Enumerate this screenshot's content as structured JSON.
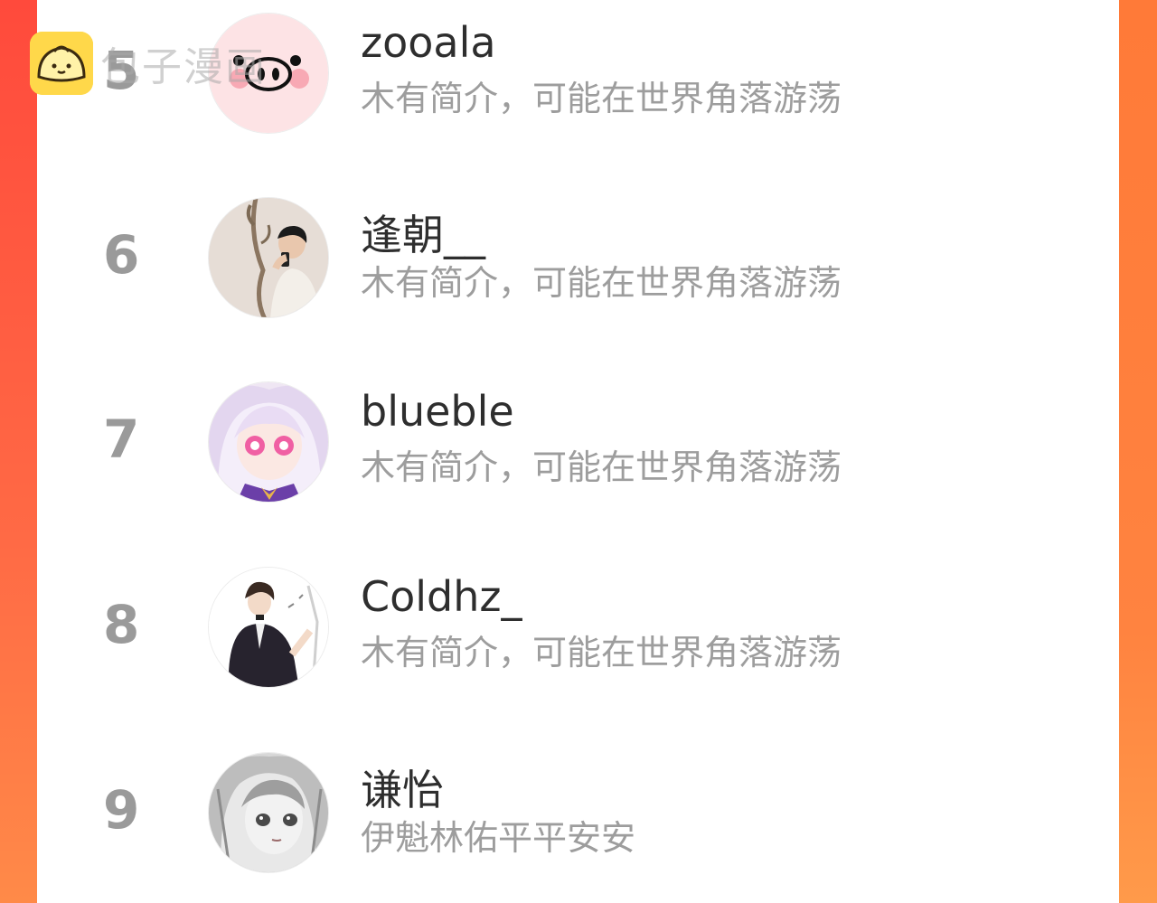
{
  "watermark": {
    "icon": "steamed-bun-icon",
    "text": "包子漫画"
  },
  "colors": {
    "frame_left": "#ff4a3c",
    "frame_right": "#ff8340",
    "rank_text": "#9a9a9a",
    "name_text": "#2e2e2e",
    "bio_text": "#9d9d9d"
  },
  "rankings": [
    {
      "rank": "5",
      "name": "zooala",
      "bio": "木有简介，可能在世界角落游荡",
      "avatar": "pig-face-avatar"
    },
    {
      "rank": "6",
      "name": "逢朝__",
      "bio": "木有简介，可能在世界角落游荡",
      "avatar": "mirror-selfie-avatar"
    },
    {
      "rank": "7",
      "name": "blueble",
      "bio": "木有简介，可能在世界角落游荡",
      "avatar": "anime-girl-avatar"
    },
    {
      "rank": "8",
      "name": "Coldhz_",
      "bio": "木有简介，可能在世界角落游荡",
      "avatar": "anime-boy-suit-avatar"
    },
    {
      "rank": "9",
      "name": "谦怡",
      "bio": "伊魁林佑平平安安",
      "avatar": "anime-grey-hair-avatar"
    }
  ]
}
